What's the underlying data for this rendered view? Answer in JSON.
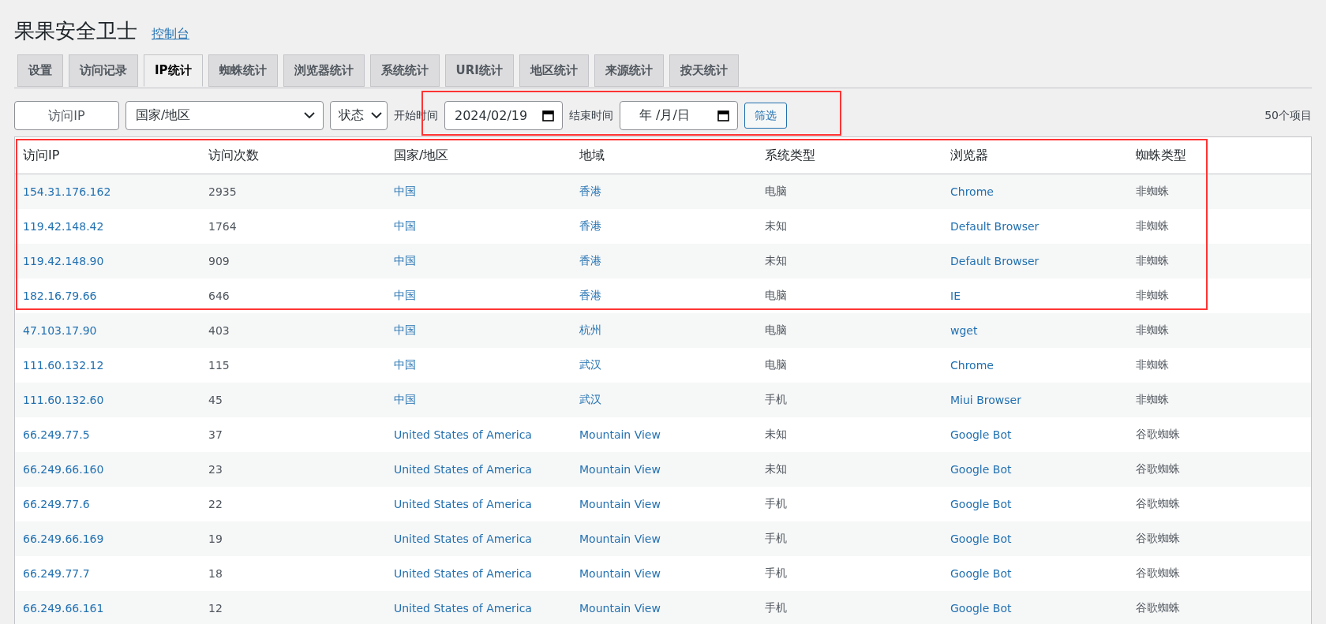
{
  "header": {
    "title": "果果安全卫士",
    "link": "控制台"
  },
  "tabs": [
    {
      "label": "设置",
      "selected": false
    },
    {
      "label": "访问记录",
      "selected": false
    },
    {
      "label": "IP统计",
      "selected": true
    },
    {
      "label": "蜘蛛统计",
      "selected": false
    },
    {
      "label": "浏览器统计",
      "selected": false
    },
    {
      "label": "系统统计",
      "selected": false
    },
    {
      "label": "URI统计",
      "selected": false
    },
    {
      "label": "地区统计",
      "selected": false
    },
    {
      "label": "来源统计",
      "selected": false
    },
    {
      "label": "按天统计",
      "selected": false
    }
  ],
  "filters": {
    "ip_field": {
      "placeholder": "访问IP"
    },
    "country_select": {
      "value": "国家/地区"
    },
    "status_select": {
      "value": "状态"
    },
    "start_label": "开始时间",
    "start_date": {
      "value": "2024/02/19"
    },
    "end_label": "结束时间",
    "end_date": {
      "placeholder": "年 /月/日"
    },
    "button": "筛选",
    "count": "50个项目"
  },
  "table": {
    "columns": [
      {
        "label": "访问IP",
        "kind": "link"
      },
      {
        "label": "访问次数",
        "kind": "text"
      },
      {
        "label": "国家/地区",
        "kind": "link"
      },
      {
        "label": "地域",
        "kind": "link"
      },
      {
        "label": "系统类型",
        "kind": "text"
      },
      {
        "label": "浏览器",
        "kind": "link"
      },
      {
        "label": "蜘蛛类型",
        "kind": "text"
      }
    ],
    "rows": [
      [
        "154.31.176.162",
        "2935",
        "中国",
        "香港",
        "电脑",
        "Chrome",
        "非蜘蛛"
      ],
      [
        "119.42.148.42",
        "1764",
        "中国",
        "香港",
        "未知",
        "Default Browser",
        "非蜘蛛"
      ],
      [
        "119.42.148.90",
        "909",
        "中国",
        "香港",
        "未知",
        "Default Browser",
        "非蜘蛛"
      ],
      [
        "182.16.79.66",
        "646",
        "中国",
        "香港",
        "电脑",
        "IE",
        "非蜘蛛"
      ],
      [
        "47.103.17.90",
        "403",
        "中国",
        "杭州",
        "电脑",
        "wget",
        "非蜘蛛"
      ],
      [
        "111.60.132.12",
        "115",
        "中国",
        "武汉",
        "电脑",
        "Chrome",
        "非蜘蛛"
      ],
      [
        "111.60.132.60",
        "45",
        "中国",
        "武汉",
        "手机",
        "Miui Browser",
        "非蜘蛛"
      ],
      [
        "66.249.77.5",
        "37",
        "United States of America",
        "Mountain View",
        "未知",
        "Google Bot",
        "谷歌蜘蛛"
      ],
      [
        "66.249.66.160",
        "23",
        "United States of America",
        "Mountain View",
        "未知",
        "Google Bot",
        "谷歌蜘蛛"
      ],
      [
        "66.249.77.6",
        "22",
        "United States of America",
        "Mountain View",
        "手机",
        "Google Bot",
        "谷歌蜘蛛"
      ],
      [
        "66.249.66.169",
        "19",
        "United States of America",
        "Mountain View",
        "手机",
        "Google Bot",
        "谷歌蜘蛛"
      ],
      [
        "66.249.77.7",
        "18",
        "United States of America",
        "Mountain View",
        "手机",
        "Google Bot",
        "谷歌蜘蛛"
      ],
      [
        "66.249.66.161",
        "12",
        "United States of America",
        "Mountain View",
        "手机",
        "Google Bot",
        "谷歌蜘蛛"
      ]
    ]
  },
  "annotations": [
    {
      "kind": "frame"
    },
    {
      "kind": "frame"
    }
  ]
}
